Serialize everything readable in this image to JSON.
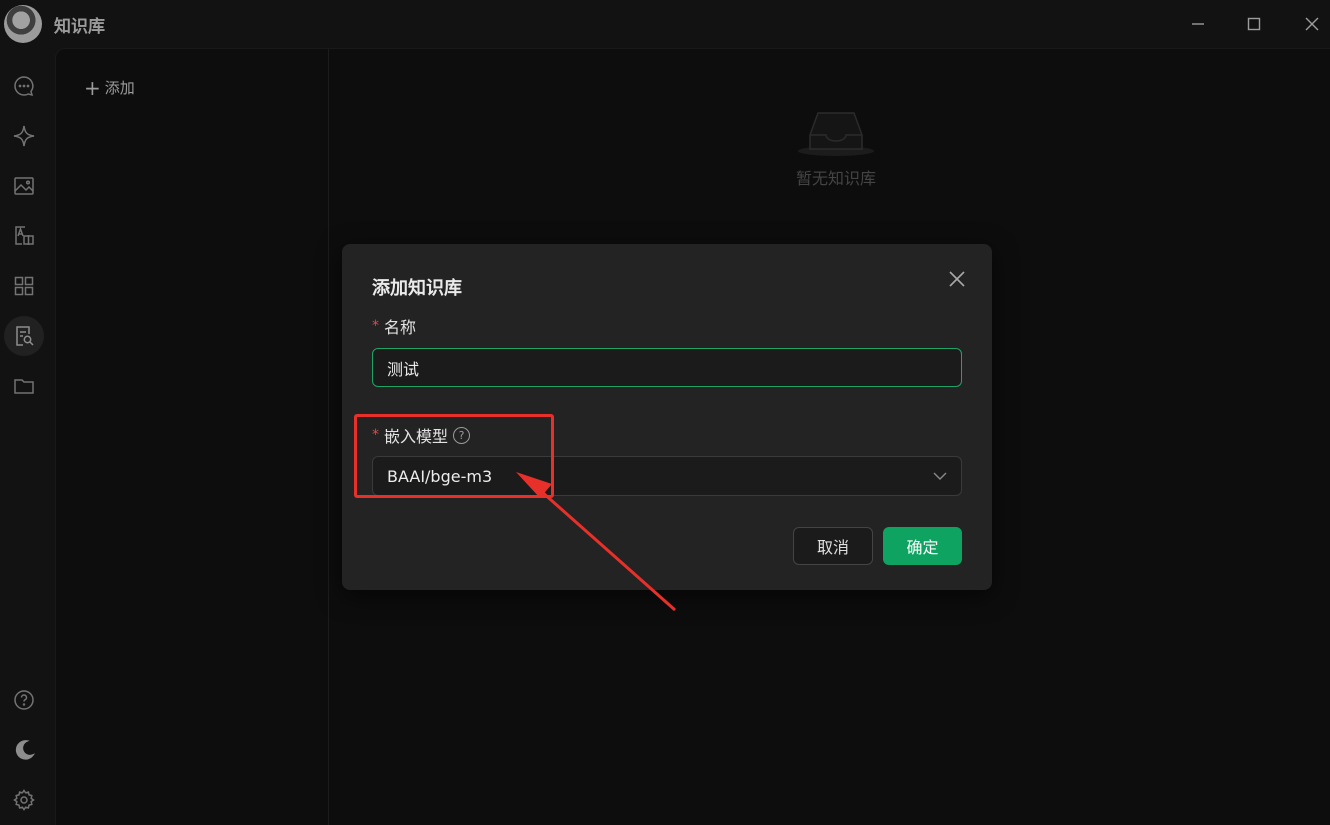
{
  "app": {
    "title": "知识库"
  },
  "window_controls": [
    {
      "name": "minimize-button",
      "icon": "minimize-icon"
    },
    {
      "name": "maximize-button",
      "icon": "maximize-icon"
    },
    {
      "name": "close-button",
      "icon": "close-icon"
    }
  ],
  "sidebar": {
    "top_items": [
      {
        "name": "sidebar-item-chat",
        "icon": "chat-bubble-icon",
        "active": false
      },
      {
        "name": "sidebar-item-assistant",
        "icon": "sparkle-icon",
        "active": false
      },
      {
        "name": "sidebar-item-images",
        "icon": "image-icon",
        "active": false
      },
      {
        "name": "sidebar-item-translate",
        "icon": "translate-icon",
        "active": false
      },
      {
        "name": "sidebar-item-apps",
        "icon": "grid-icon",
        "active": false
      },
      {
        "name": "sidebar-item-knowledge",
        "icon": "knowledge-search-icon",
        "active": true
      },
      {
        "name": "sidebar-item-files",
        "icon": "folder-icon",
        "active": false
      }
    ],
    "bottom_items": [
      {
        "name": "sidebar-item-help",
        "icon": "help-icon"
      },
      {
        "name": "sidebar-item-theme",
        "icon": "moon-icon"
      },
      {
        "name": "sidebar-item-settings",
        "icon": "gear-icon"
      }
    ]
  },
  "kb_list": {
    "add_label": "添加"
  },
  "empty_state": {
    "text": "暂无知识库",
    "icon": "empty-inbox-icon"
  },
  "dialog": {
    "title": "添加知识库",
    "name_field": {
      "label": "名称",
      "required_mark": "*",
      "value": "测试"
    },
    "model_field": {
      "label": "嵌入模型",
      "required_mark": "*",
      "help": "?",
      "selected": "BAAI/bge-m3"
    },
    "cancel_label": "取消",
    "ok_label": "确定"
  },
  "colors": {
    "accent": "#0ea360",
    "annotation": "#e8302a",
    "required": "#e04a4a"
  }
}
